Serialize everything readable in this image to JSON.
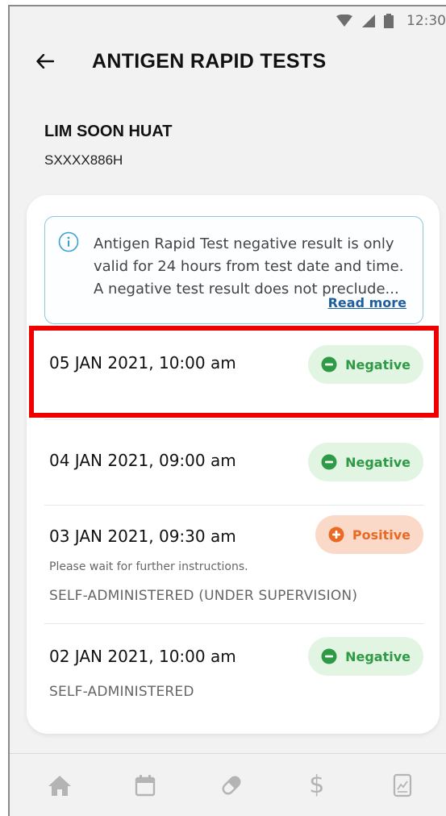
{
  "status_bar": {
    "time": "12:30",
    "icons": [
      "wifi-icon",
      "cellular-signal-icon",
      "battery-icon"
    ]
  },
  "header": {
    "title": "ANTIGEN RAPID TESTS",
    "back_icon": "arrow-left-icon"
  },
  "patient": {
    "name": "LIM SOON HUAT",
    "id": "SXXXX886H"
  },
  "notice": {
    "icon": "info-icon",
    "text": "Antigen Rapid Test negative result is only valid for 24 hours from test date and time. A negative test result does not preclude...",
    "link_label": "Read more"
  },
  "tests": [
    {
      "date": "05 JAN 2021, 10:00 am",
      "result": "Negative",
      "result_icon": "minus-circle-icon",
      "note": "",
      "mode": ""
    },
    {
      "date": "04 JAN 2021, 09:00 am",
      "result": "Negative",
      "result_icon": "minus-circle-icon",
      "note": "",
      "mode": ""
    },
    {
      "date": "03 JAN 2021, 09:30 am",
      "result": "Positive",
      "result_icon": "plus-circle-icon",
      "note": "Please wait for further instructions.",
      "mode": "SELF-ADMINISTERED (UNDER SUPERVISION)"
    },
    {
      "date": "02 JAN 2021, 10:00 am",
      "result": "Negative",
      "result_icon": "minus-circle-icon",
      "note": "",
      "mode": "SELF-ADMINISTERED"
    }
  ],
  "bottom_nav": {
    "items": [
      {
        "icon": "home-icon"
      },
      {
        "icon": "calendar-icon"
      },
      {
        "icon": "medication-pill-icon"
      },
      {
        "icon": "dollar-icon",
        "symbol": "$"
      },
      {
        "icon": "health-report-icon"
      }
    ]
  },
  "colors": {
    "negative_text": "#2f9a46",
    "negative_bg": "#e2f4e2",
    "positive_text": "#e96a25",
    "positive_bg": "#fbd9c8",
    "link": "#1f5f9e",
    "highlight": "#ee0000"
  }
}
